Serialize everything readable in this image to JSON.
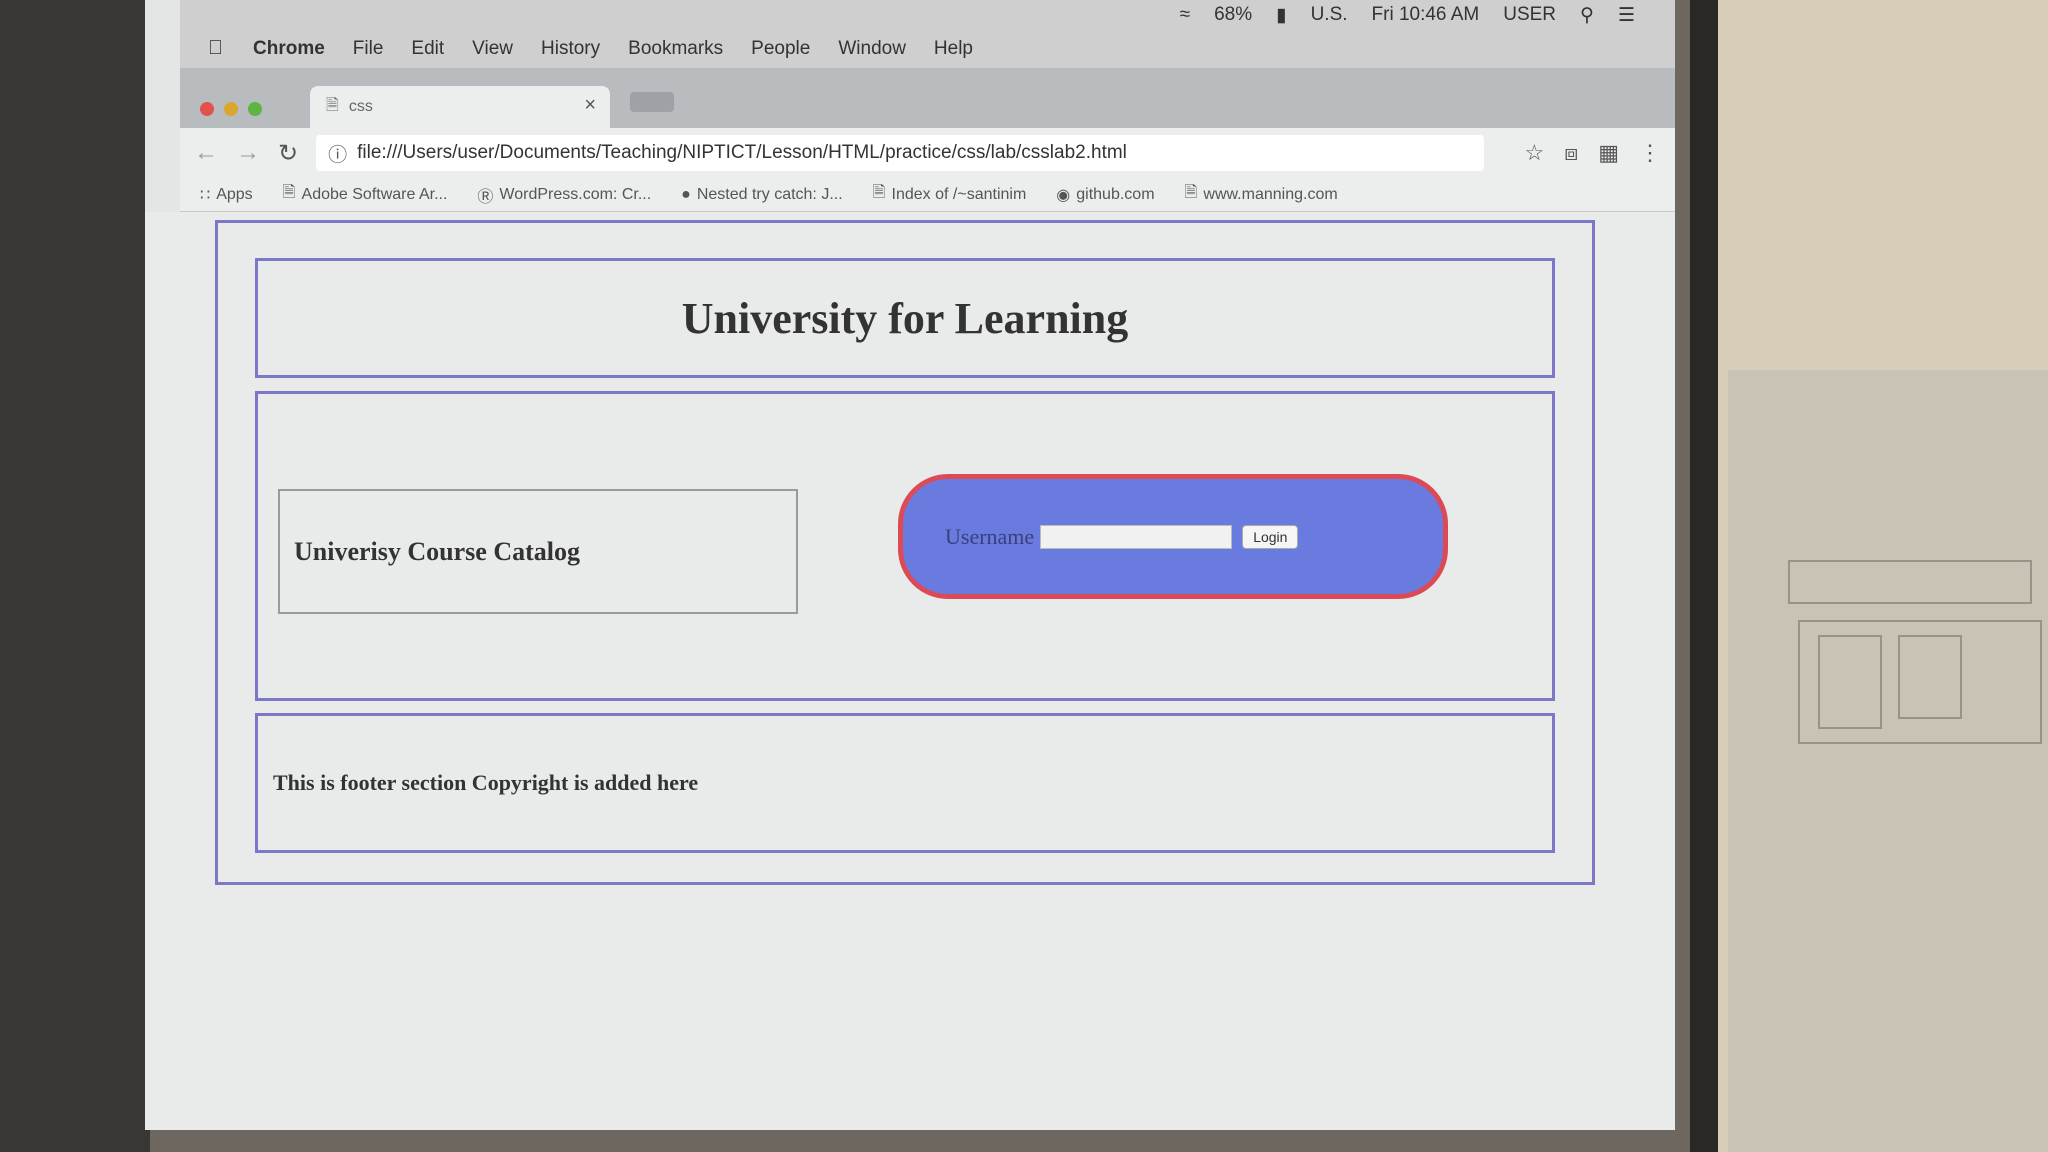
{
  "menubar": {
    "apple_icon": "apple-icon",
    "app_name": "Chrome",
    "menus": [
      "File",
      "Edit",
      "View",
      "History",
      "Bookmarks",
      "People",
      "Window",
      "Help"
    ],
    "battery": "68%",
    "input_source": "U.S.",
    "clock": "Fri 10:46 AM",
    "user": "USER"
  },
  "tab": {
    "title": "css",
    "close": "×"
  },
  "address_bar": {
    "url": "file:///Users/user/Documents/Teaching/NIPTICT/Lesson/HTML/practice/css/lab/csslab2.html"
  },
  "bookmarks": [
    "Apps",
    "Adobe Software Ar...",
    "WordPress.com: Cr...",
    "Nested try catch: J...",
    "Index of /~santinim",
    "github.com",
    "www.manning.com"
  ],
  "page": {
    "title": "University for Learning",
    "catalog_label": "Univerisy Course Catalog",
    "username_label": "Username",
    "username_value": "",
    "login_button": "Login",
    "footer_text": "This is footer section Copyright is added here"
  },
  "colors": {
    "border_blue": "#7b78c9",
    "login_fill": "#6a7be0",
    "login_border": "#dc4a55"
  }
}
